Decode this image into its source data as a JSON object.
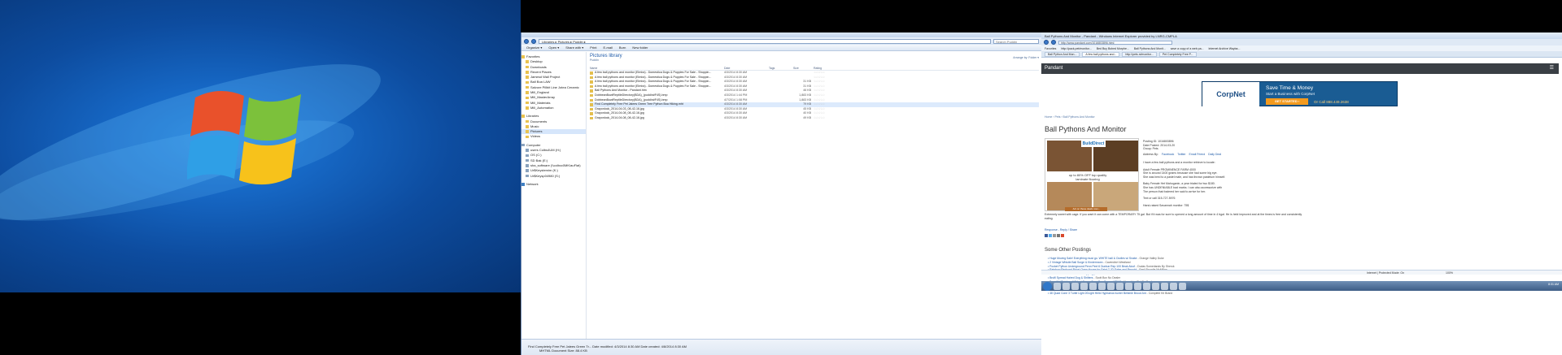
{
  "explorer": {
    "address": "Libraries ▸ Pictures ▸ Puddin ▸",
    "search_placeholder": "Search Puddin",
    "commands": [
      "Organize ▾",
      "Open ▾",
      "Share with ▾",
      "Print",
      "E-mail",
      "Burn",
      "New folder"
    ],
    "nav": [
      "Favorites",
      "Desktop",
      "Downloads",
      "Recent Places",
      "Jamesd Wall Project",
      "Ball Boa LAW",
      "Salvore Pillbit Line Jotea Ceramic",
      "Mill_England",
      "Mill_MasterArray",
      "Mill_Materials",
      "Mill_Automation",
      "Libraries",
      "Documents",
      "Music",
      "Pictures",
      "Videos",
      "Computer",
      "users Colbs4UM (H:)",
      "OS (C:)",
      "SD Bak (E:)",
      "sha_software (\\\\colbcc0MK\\auFlat)",
      "Ur$Keystemim (K:)",
      "Ur$Keysp04980 (S:)",
      "Network"
    ],
    "library_title": "Pictures library",
    "library_sub": "Puddin",
    "arrange_by": "Arrange by:  Folder ▾",
    "columns": {
      "name": "Name",
      "date": "Date",
      "tags": "Tags",
      "size": "Size",
      "rating": "Rating"
    },
    "files": [
      {
        "name": "A few ball pythons and monitor (Elmira) - Domestica Dogs & Puppies For Sale - Shoppin...",
        "date": "4/3/2014 8:30 AM",
        "size": ""
      },
      {
        "name": "A few ball pythons and monitor (Elmira) - Domestica Dogs & Puppies For Sale - Shoppin...",
        "date": "4/3/2014 8:30 AM",
        "size": ""
      },
      {
        "name": "A few ball pythons and monitor (Elmira) - Domestica Dogs & Puppies For Sale - Shoppin...",
        "date": "4/3/2014 8:30 AM",
        "size": "31 KB"
      },
      {
        "name": "A few ball pythons and monitor (Elmira) - Domestica Dogs & Puppies For Sale - Shoppin...",
        "date": "4/3/2014 8:30 AM",
        "size": "31 KB"
      },
      {
        "name": "Ball Pythons And Monitor - Pandant.htm",
        "date": "4/3/2014 8:30 AM",
        "size": "46 KB"
      },
      {
        "name": "DobbeanBowlReptileDirectory(BDA)_(puddin#F4S).bmp",
        "date": "4/3/2014 1:44 PM",
        "size": "1,883 KB"
      },
      {
        "name": "DobbeanBowlReptileDirectory(BDA)_(puddin#F4S).bmp",
        "date": "4/7/2014 1:08 PM",
        "size": "1,883 KB"
      },
      {
        "name": "Find Completely Free Pet Jalees Green Tree Python Boa Hiking.mht",
        "date": "4/3/2014 8:30 AM",
        "size": "79 KB"
      },
      {
        "name": "Grayonlock_2014-04-03_08-42-16.jpg",
        "date": "4/3/2014 8:30 AM",
        "size": "45 KB"
      },
      {
        "name": "Grayonlock_2014-04-08_08-42-16.jpg",
        "date": "4/3/2014 8:30 AM",
        "size": "40 KB"
      },
      {
        "name": "Grayonlock_2014-04-08_08-42-16.jpg",
        "date": "4/3/2014 8:30 AM",
        "size": "49 KB"
      }
    ],
    "details": "Find Completely Free Pet Jalees Green Tr...   Date modified: 4/3/2014 8:30 AM      Date created: 4/8/2014 8:30 AM",
    "details2": "MHTML Document      Size: 88.4 KB"
  },
  "ie": {
    "title": "Ball Pythons And Monitor - Pandant - Windows Internet Explorer provided by LNRG-CMPLA",
    "url": "http://www.pandant.com/1016803896.html",
    "favorites": [
      "Favorites",
      "http://pack.pet/monitor...",
      "Bed Buy Bobed Morphe...",
      "Ball Pythons And Monit...",
      "save a copy of a web pa...",
      "Internet Archive Wayba...",
      "Ball Python And Mon...",
      "A few ball pythons and...",
      "http://pets.ni/monitor...",
      "Pet Completely Free P..."
    ],
    "site_name": "Pandant",
    "breadcrumbs": "Home  ›  Pets  ›  Ball Pythons And Monitor",
    "ad": {
      "logo": "CorpNet",
      "line1": "Save Time & Money",
      "line2": "Start a Business with CorpNet",
      "cta": "GET STARTED ›",
      "phone": "Or Call 888.449.2638"
    },
    "post_title": "Ball Pythons And Monitor",
    "img_ad": {
      "brand": "BuildDirect",
      "offer": "up to 80% OFF top quality laminate flooring",
      "button": "Act on these deals now ›"
    },
    "info": [
      "Posting ID: 1016803896",
      "Date Posted: 2014-03-20",
      "Group: Pets"
    ],
    "address_by": "Address By:",
    "share_links": [
      "Facebook",
      "Twitter",
      "Email Friend",
      "Daily Deal"
    ],
    "desc": [
      "I have a few ball pythons and a monitor retrieve to locate:",
      "Adult Female PROMINENCE FARM 4000",
      "She is around 1400 grams because she had some big eye.",
      "She was bred to a pastel male, and has thrown pastelum himself.",
      "Baby Female Het Mahoganin, a year trialed for two $180.",
      "She has UNDENIABLE bad marks. I can also accessorize with",
      "The person that fostered her said to arrive for her.",
      "Text or call 315-727-5976"
    ],
    "monitor_line": "Hand-raised Savannah monitor: 75$",
    "full_desc": "Extremely sweet with cage. If you want it can come with a TEMPORARY 75 gal. But if it was for sure to opened a long amount of time in 4 bgal. He is held improved and at the times is free and consistently eating.",
    "reply": "Response - Reply / Share",
    "other_heading": "Some Other Postings",
    "other_postings": [
      {
        "text": "• Huge Moving Sale! Everything must go. WHITE ball & Oodles w/ Snake",
        "loc": " - Orange Valley Duke"
      },
      {
        "text": "• 2 Vintage Whistle Ball Surge & Kindermann",
        "loc": " - Cavendish Westland"
      },
      {
        "text": "• Pocket Python Underground Penn Peel 6 Dunbar Rep 100 Beak Aloof",
        "loc": " - Dudas Somerlands By Sherok"
      },
      {
        "text": "• Rainbow Reduced Price! Open House for Saint 7 JD Sales and Beauty!",
        "loc": " - Basil Broadie McMillan"
      },
      {
        "text": "• Boxed Beauteur recurrent shopping platform",
        "loc": " - Scott Box No Dealer"
      },
      {
        "text": "• Brufil Spread Haired Dog & Shitters",
        "loc": " - Scott Box No Dealer"
      },
      {
        "text": "• Beautiful Rainbow Wildcat ConsorZone Dan Brower! $7.00",
        "loc": " - Nova Live Rubfile Snake"
      },
      {
        "text": "• Raspsound Pet Boas 15\" 2 Tipis 17 Tipis 4 Bass 6 Boards Kit Bond",
        "loc": " - Complete Kit Brand"
      },
      {
        "text": "• Albinoid Boa Hydro Kosmond Mount Rep Mount Nonvolley",
        "loc": " - Yes Blade No Dealer"
      },
      {
        "text": "• 48 Quad Cone 3 Turtle Light 20Light Helix Hyphaeus hunter Belishle Brood Ant",
        "loc": " - Complete Kit Brand"
      }
    ],
    "status": "Internet | Protected Mode: On",
    "zoom": "100%",
    "clock": "8:31 AM"
  }
}
